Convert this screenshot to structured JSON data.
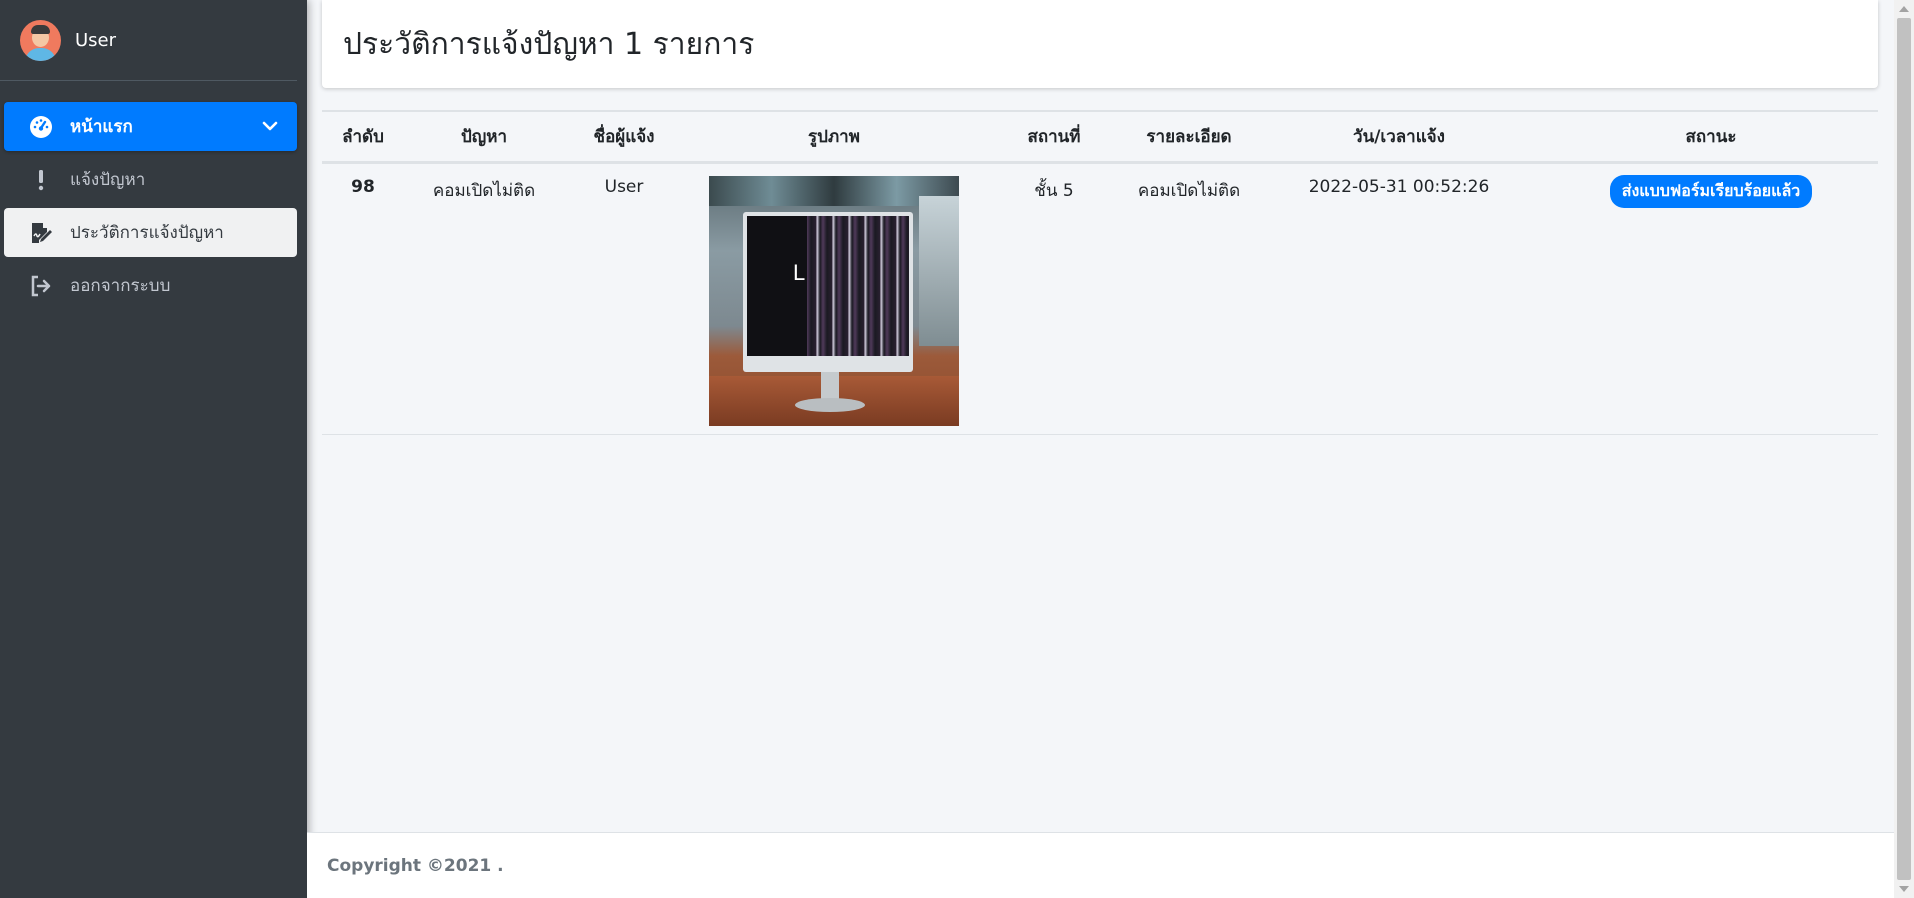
{
  "sidebar": {
    "user_name": "User",
    "items": [
      {
        "label": "หน้าแรก",
        "icon": "dashboard-icon",
        "state": "active"
      },
      {
        "label": "แจ้งปัญหา",
        "icon": "exclamation-icon",
        "state": "normal"
      },
      {
        "label": "ประวัติการแจ้งปัญหา",
        "icon": "signature-icon",
        "state": "current"
      },
      {
        "label": "ออกจากระบบ",
        "icon": "sign-out-icon",
        "state": "normal"
      }
    ]
  },
  "header": {
    "title": "ประวัติการแจ้งปัญหา 1 รายการ"
  },
  "table": {
    "columns": [
      "ลำดับ",
      "ปัญหา",
      "ชื่อผู้แจ้ง",
      "รูปภาพ",
      "สถานที่",
      "รายละเอียด",
      "วัน/เวลาแจ้ง",
      "สถานะ"
    ],
    "rows": [
      {
        "number": "98",
        "problem": "คอมเปิดไม่ติด",
        "reporter": "User",
        "image": "broken-monitor-photo",
        "location": "ชั้น 5",
        "details": "คอมเปิดไม่ติด",
        "datetime": "2022-05-31 00:52:26",
        "status": "ส่งแบบฟอร์มเรียบร้อยแล้ว"
      }
    ]
  },
  "footer": {
    "copyright": "Copyright ©2021 ."
  },
  "colors": {
    "sidebar_bg": "#343a40",
    "accent": "#007bff",
    "page_bg": "#f4f6f9"
  }
}
